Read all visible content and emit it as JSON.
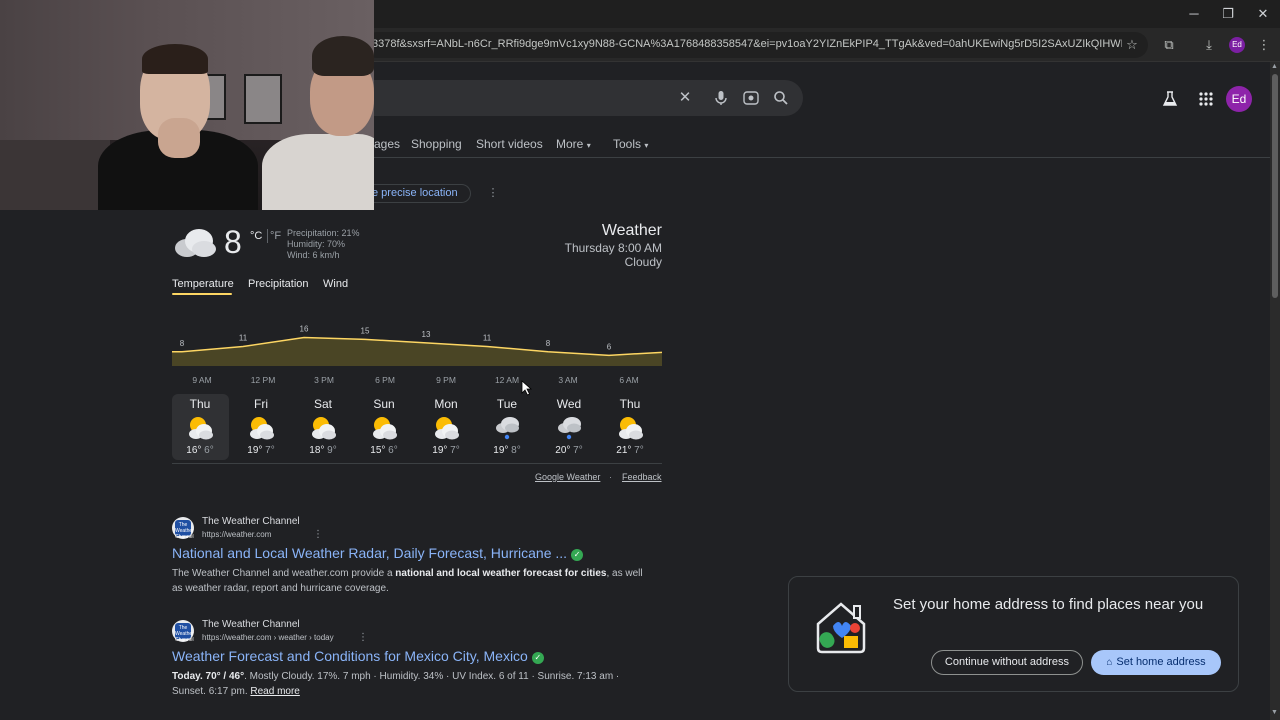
{
  "browser": {
    "url": "3378f&sxsrf=ANbL-n6Cr_RRfi9dge9mVc1xy9N88-GCNA%3A1768488358547&ei=pv1oaY2YIZnEkPIP4_TTgAk&ved=0ahUKEwiNg5rD5I2SAxUZIkQIHWP6FJAQ4d...",
    "profile_initials": "Ed",
    "icons": {
      "minimize": "minimize-icon",
      "restore": "restore-icon",
      "close": "close-icon",
      "star": "bookmark-star-icon",
      "extensions": "extensions-icon",
      "download": "download-icon",
      "menu": "kebab-menu-icon"
    }
  },
  "search": {
    "icons": [
      "clear-icon",
      "microphone-icon",
      "lens-icon",
      "search-icon"
    ]
  },
  "header": {
    "labs_icon": "flask-icon",
    "apps_icon": "apps-grid-icon",
    "user_initials": "Ed"
  },
  "nav_tabs": [
    {
      "label": "ages"
    },
    {
      "label": "Shopping"
    },
    {
      "label": "Short videos"
    },
    {
      "label": "More",
      "caret": "▾"
    },
    {
      "label": "Tools",
      "caret": "▾"
    }
  ],
  "location_chip": {
    "label": "e precise location"
  },
  "weather": {
    "current_temp": "8",
    "unit_c": "°C",
    "unit_f": "°F",
    "precipitation": "Precipitation: 21%",
    "humidity": "Humidity: 70%",
    "wind": "Wind: 6 km/h",
    "title": "Weather",
    "datetime": "Thursday 8:00 AM",
    "condition": "Cloudy",
    "tabs": [
      "Temperature",
      "Precipitation",
      "Wind"
    ],
    "active_tab": "Temperature",
    "footer_source": "Google Weather",
    "footer_separator": "·",
    "footer_feedback": "Feedback",
    "days": [
      {
        "name": "Thu",
        "hi": "16°",
        "lo": "6°",
        "icon": "partly-cloudy-icon",
        "selected": true
      },
      {
        "name": "Fri",
        "hi": "19°",
        "lo": "7°",
        "icon": "partly-cloudy-icon"
      },
      {
        "name": "Sat",
        "hi": "18°",
        "lo": "9°",
        "icon": "partly-cloudy-icon"
      },
      {
        "name": "Sun",
        "hi": "15°",
        "lo": "6°",
        "icon": "partly-cloudy-icon"
      },
      {
        "name": "Mon",
        "hi": "19°",
        "lo": "7°",
        "icon": "partly-cloudy-icon"
      },
      {
        "name": "Tue",
        "hi": "19°",
        "lo": "8°",
        "icon": "cloud-rain-icon"
      },
      {
        "name": "Wed",
        "hi": "20°",
        "lo": "7°",
        "icon": "cloud-rain-icon"
      },
      {
        "name": "Thu",
        "hi": "21°",
        "lo": "7°",
        "icon": "partly-cloudy-icon"
      }
    ]
  },
  "chart_data": {
    "type": "area",
    "x": [
      "9 AM",
      "12 PM",
      "3 PM",
      "6 PM",
      "9 PM",
      "12 AM",
      "3 AM",
      "6 AM"
    ],
    "values": [
      8,
      11,
      16,
      15,
      13,
      11,
      8,
      6
    ],
    "ylim": [
      0,
      18
    ],
    "color": "#fdd663"
  },
  "results": [
    {
      "site": "The Weather Channel",
      "url": "https://weather.com",
      "title": "National and Local Weather Radar, Daily Forecast, Hurricane ...",
      "snippet_pre": "The Weather Channel and weather.com provide a ",
      "snippet_bold": "national and local weather forecast for cities",
      "snippet_post": ", as well as weather radar, report and hurricane coverage.",
      "favicon_text": "The Weather Channel"
    },
    {
      "site": "The Weather Channel",
      "url": "https://weather.com › weather › today",
      "title": "Weather Forecast and Conditions for Mexico City, Mexico",
      "snippet_bold": "Today. 70° / 46°",
      "snippet_post": ". Mostly Cloudy. 17%. 7 mph · Humidity. 34% · UV Index. 6 of 11 · Sunrise. 7:13 am · Sunset. 6:17 pm.",
      "read_more": "Read more",
      "favicon_text": "The Weather Channel"
    }
  ],
  "address_card": {
    "title": "Set your home address to find places near you",
    "continue_label": "Continue without address",
    "set_label": "Set home address"
  }
}
